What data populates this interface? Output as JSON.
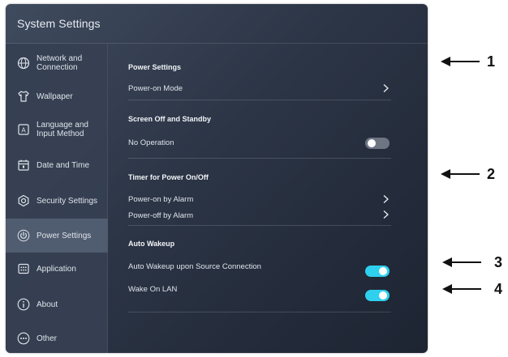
{
  "app": {
    "title": "System Settings"
  },
  "sidebar": {
    "items": [
      {
        "label": "Network and Connection",
        "icon": "globe-icon"
      },
      {
        "label": "Wallpaper",
        "icon": "shirt-icon"
      },
      {
        "label": "Language and Input Method",
        "icon": "keyboard-a-icon"
      },
      {
        "label": "Date and Time",
        "icon": "calendar-icon"
      },
      {
        "label": "Security Settings",
        "icon": "shield-gear-icon"
      },
      {
        "label": "Power Settings",
        "icon": "power-icon",
        "active": true
      },
      {
        "label": "Application",
        "icon": "grid-apps-icon"
      },
      {
        "label": "About",
        "icon": "info-icon"
      },
      {
        "label": "Other",
        "icon": "more-icon"
      }
    ]
  },
  "main": {
    "sections": {
      "power_settings": "Power Settings",
      "screen_off": "Screen Off and Standby",
      "timer": "Timer for Power On/Off",
      "auto_wakeup": "Auto Wakeup"
    },
    "rows": {
      "power_on_mode": "Power-on Mode",
      "no_operation": {
        "label": "No Operation",
        "enabled": false
      },
      "power_on_alarm": "Power-on by Alarm",
      "power_off_alarm": "Power-off by Alarm",
      "auto_wakeup_source": {
        "label": "Auto Wakeup upon Source Connection",
        "enabled": true
      },
      "wake_on_lan": {
        "label": "Wake On LAN",
        "enabled": true
      }
    }
  },
  "callouts": [
    "1",
    "2",
    "3",
    "4"
  ],
  "colors": {
    "toggle_on": "#2ed0ee",
    "toggle_off": "#6d7583",
    "sidebar_active": "#505c70"
  }
}
